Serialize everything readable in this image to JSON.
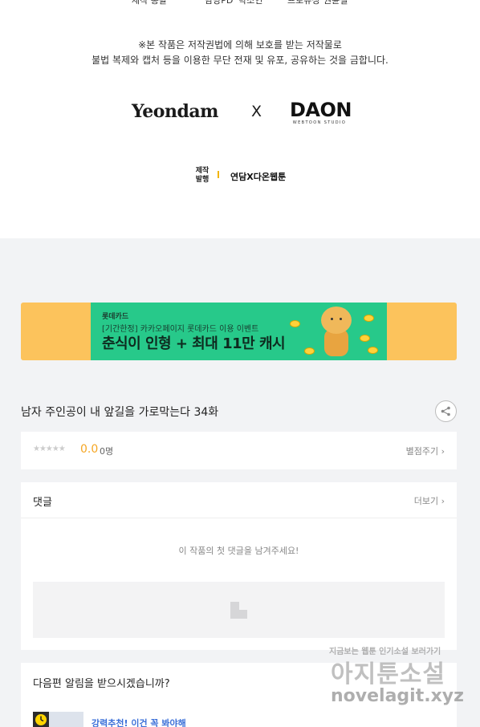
{
  "credits_top": {
    "col1": "제작 총괄",
    "col2": "담당PD",
    "col2_name": "박소연",
    "col3": "프로듀싱",
    "col3_name": "권윤철"
  },
  "notice": {
    "line1": "※본 작품은 저작권법에 의해 보호를 받는 저작물로",
    "line2": "불법 복제와 캡처 등을 이용한 무단 전재 및 유포, 공유하는 것을 금합니다."
  },
  "logos": {
    "left": "Yeondam",
    "cross": "X",
    "right": "DAON",
    "right_sub": "WEBTOON STUDIO"
  },
  "credit": {
    "key1": "제작",
    "key2": "발행",
    "value": "연담X다온웹툰"
  },
  "banner": {
    "brand": "롯데카드",
    "subtitle": "[기간한정] 카카오페이지 롯데카드 이용 이벤트",
    "title": "춘식이 인형 + 최대 11만 캐시"
  },
  "episode": {
    "title": "남자 주인공이 내 앞길을 가로막는다 34화"
  },
  "rating": {
    "stars": "★★★★★",
    "score": "0.0",
    "count": "0명",
    "rate_label": "별점주기 ›"
  },
  "comments": {
    "title": "댓글",
    "more": "더보기 ›",
    "empty": "이 작품의 첫 댓글을 남겨주세요!"
  },
  "notify": {
    "question": "다음편 알림을 받으시겠습니까?",
    "item_title": "강력추천! 이건 꼭 봐야해"
  },
  "watermark": {
    "line1": "지금보는 웹툰 인기소설 보러가기",
    "line2": "아지툰소설",
    "line3": "novelagit.xyz"
  },
  "colors": {
    "banner_outer": "#fcc35c",
    "banner_inner": "#27c98a",
    "score": "#f5a623",
    "link_blue": "#3a6fd8"
  }
}
